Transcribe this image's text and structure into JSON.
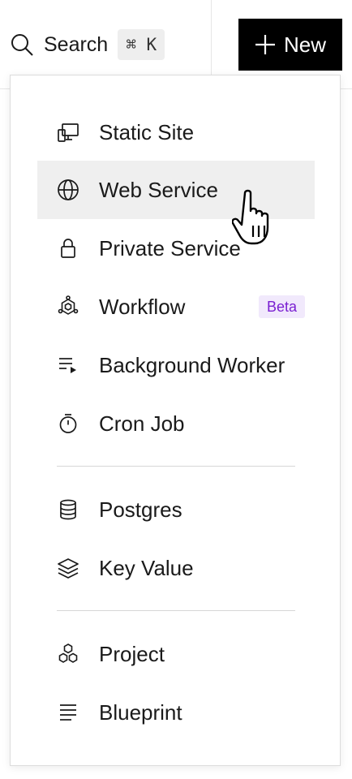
{
  "topbar": {
    "search_label": "Search",
    "search_shortcut": "⌘ K",
    "new_button_label": "New"
  },
  "menu": {
    "groups": [
      [
        {
          "label": "Static Site",
          "icon": "static-site-icon"
        },
        {
          "label": "Web Service",
          "icon": "globe-icon",
          "hovered": true
        },
        {
          "label": "Private Service",
          "icon": "lock-icon"
        },
        {
          "label": "Workflow",
          "icon": "workflow-icon",
          "badge": "Beta"
        },
        {
          "label": "Background Worker",
          "icon": "background-worker-icon"
        },
        {
          "label": "Cron Job",
          "icon": "stopwatch-icon"
        }
      ],
      [
        {
          "label": "Postgres",
          "icon": "database-icon"
        },
        {
          "label": "Key Value",
          "icon": "layers-icon"
        }
      ],
      [
        {
          "label": "Project",
          "icon": "project-icon"
        },
        {
          "label": "Blueprint",
          "icon": "blueprint-icon"
        }
      ]
    ]
  },
  "colors": {
    "badge_text": "#7a1fd1",
    "badge_bg": "#f1e9fc",
    "hover_bg": "#efefef",
    "new_button_bg": "#000000"
  }
}
